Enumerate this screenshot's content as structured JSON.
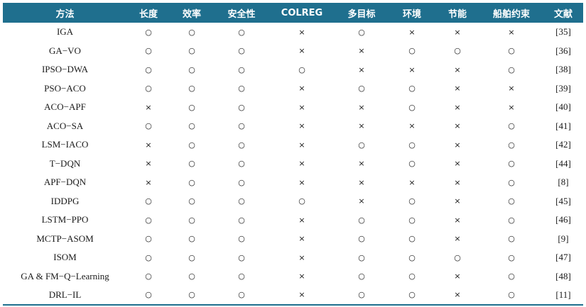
{
  "table": {
    "headers": [
      "方法",
      "长度",
      "效率",
      "安全性",
      "COLREG",
      "多目标",
      "环境",
      "节能",
      "船舶约束",
      "文献"
    ],
    "rows": [
      [
        "IGA",
        "○",
        "○",
        "○",
        "×",
        "○",
        "×",
        "×",
        "×",
        "[35]"
      ],
      [
        "GA−VO",
        "○",
        "○",
        "○",
        "×",
        "×",
        "○",
        "○",
        "○",
        "[36]"
      ],
      [
        "IPSO−DWA",
        "○",
        "○",
        "○",
        "○",
        "×",
        "×",
        "×",
        "○",
        "[38]"
      ],
      [
        "PSO−ACO",
        "○",
        "○",
        "○",
        "×",
        "○",
        "○",
        "×",
        "×",
        "[39]"
      ],
      [
        "ACO−APF",
        "×",
        "○",
        "○",
        "×",
        "×",
        "○",
        "×",
        "×",
        "[40]"
      ],
      [
        "ACO−SA",
        "○",
        "○",
        "○",
        "×",
        "×",
        "×",
        "×",
        "○",
        "[41]"
      ],
      [
        "LSM−IACO",
        "×",
        "○",
        "○",
        "×",
        "○",
        "○",
        "×",
        "○",
        "[42]"
      ],
      [
        "T−DQN",
        "×",
        "○",
        "○",
        "×",
        "×",
        "○",
        "×",
        "○",
        "[44]"
      ],
      [
        "APF−DQN",
        "×",
        "○",
        "○",
        "×",
        "×",
        "×",
        "×",
        "○",
        "[8]"
      ],
      [
        "IDDPG",
        "○",
        "○",
        "○",
        "○",
        "×",
        "○",
        "×",
        "○",
        "[45]"
      ],
      [
        "LSTM−PPO",
        "○",
        "○",
        "○",
        "×",
        "○",
        "○",
        "×",
        "○",
        "[46]"
      ],
      [
        "MCTP−ASOM",
        "○",
        "○",
        "○",
        "×",
        "○",
        "○",
        "×",
        "○",
        "[9]"
      ],
      [
        "ISOM",
        "○",
        "○",
        "○",
        "×",
        "○",
        "○",
        "○",
        "○",
        "[47]"
      ],
      [
        "GA & FM−Q−Learning",
        "○",
        "○",
        "○",
        "×",
        "○",
        "○",
        "×",
        "○",
        "[48]"
      ],
      [
        "DRL−IL",
        "○",
        "○",
        "○",
        "×",
        "○",
        "○",
        "×",
        "○",
        "[11]"
      ]
    ]
  },
  "colors": {
    "header_bg": "#1f6f8e",
    "header_text": "#ffffff"
  }
}
